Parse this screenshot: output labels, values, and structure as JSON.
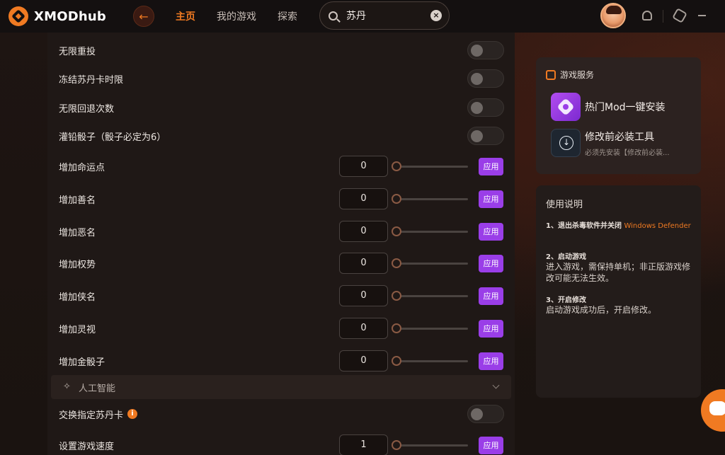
{
  "app": {
    "name": "XMODhub",
    "accent_color": "#f07a22",
    "button_color": "#9a3ee8"
  },
  "nav": {
    "items": [
      {
        "label": "主页",
        "active": true
      },
      {
        "label": "我的游戏",
        "active": false
      },
      {
        "label": "探索",
        "active": false
      }
    ]
  },
  "search": {
    "value": "苏丹",
    "clear_icon": "close-icon"
  },
  "toggles": [
    {
      "label": "无限重投",
      "on": false
    },
    {
      "label": "冻结苏丹卡时限",
      "on": false
    },
    {
      "label": "无限回退次数",
      "on": false
    },
    {
      "label": "灌铅骰子（骰子必定为6）",
      "on": false
    }
  ],
  "sliders": [
    {
      "label": "增加命运点",
      "value": "0",
      "button": "应用"
    },
    {
      "label": "增加善名",
      "value": "0",
      "button": "应用"
    },
    {
      "label": "增加恶名",
      "value": "0",
      "button": "应用"
    },
    {
      "label": "增加权势",
      "value": "0",
      "button": "应用"
    },
    {
      "label": "增加侠名",
      "value": "0",
      "button": "应用"
    },
    {
      "label": "增加灵视",
      "value": "0",
      "button": "应用"
    },
    {
      "label": "增加金骰子",
      "value": "0",
      "button": "应用"
    }
  ],
  "section": {
    "title": "人工智能"
  },
  "ai_rows": {
    "swap": {
      "label": "交换指定苏丹卡",
      "info": "i",
      "on": false
    },
    "speed": {
      "label": "设置游戏速度",
      "value": "1",
      "button": "应用"
    }
  },
  "services": {
    "title": "游戏服务",
    "items": [
      {
        "name": "热门Mod一键安装",
        "sub": ""
      },
      {
        "name": "修改前必装工具",
        "sub": "必须先安装【修改前必装..."
      }
    ]
  },
  "guide": {
    "title": "使用说明",
    "steps": [
      {
        "title": "1、退出杀毒软件并关闭",
        "accent": "Windows Defender",
        "body": ""
      },
      {
        "title": "2、启动游戏",
        "accent": "",
        "body": "进入游戏，需保持单机；非正版游戏修改可能无法生效。"
      },
      {
        "title": "3、开启修改",
        "accent": "",
        "body": "启动游戏成功后，开启修改。"
      }
    ]
  }
}
